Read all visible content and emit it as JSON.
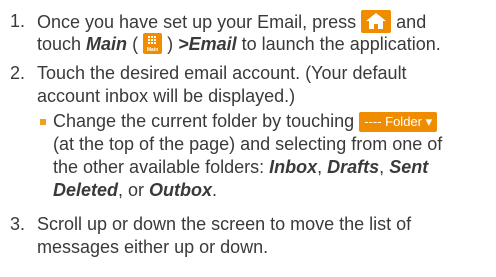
{
  "steps": [
    {
      "number": "1.",
      "line1_before": "Once you have set up your Email, press ",
      "line1_after": " and",
      "line2_before": "touch ",
      "main_label": "Main",
      "paren_open": " ( ",
      "paren_close": " ) ",
      "arrow": ">",
      "email_label": "Email",
      "line2_after": " to launch the application."
    },
    {
      "number": "2.",
      "line1": "Touch the desired email account. (Your default",
      "line2": "account inbox will be displayed.)"
    },
    {
      "number": "3.",
      "line1": "Scroll up or down the screen to move the list of",
      "line2": "messages either up or down."
    }
  ],
  "bullet": {
    "line1_before": "Change the current folder by touching ",
    "line2": "(at the top of the page) and selecting from one of",
    "line3_before": "the other available folders: ",
    "folders": [
      "Inbox",
      "Drafts",
      "Sent",
      "Deleted",
      "Outbox"
    ],
    "sep1": ", ",
    "sep_or": ", or ",
    "end": "."
  },
  "icons": {
    "home": "home-icon",
    "main_icon_label": "Main",
    "folder_button_label": "---- Folder ▾"
  },
  "colors": {
    "accent": "#f08c00",
    "bullet": "#f0a020",
    "text": "#3a3a3a"
  }
}
